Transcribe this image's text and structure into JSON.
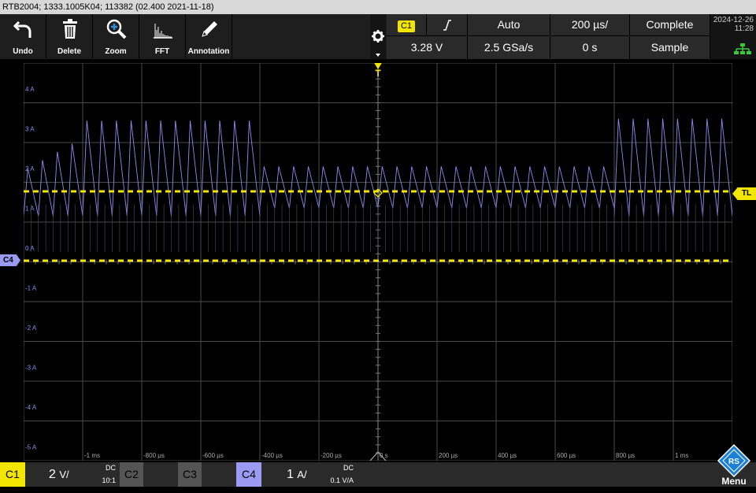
{
  "titlebar": {
    "text": "RTB2004; 1333.1005K04; 113382 (02.400 2021-11-18)"
  },
  "toolbar": [
    {
      "label": "Undo",
      "icon": "undo-icon"
    },
    {
      "label": "Delete",
      "icon": "trash-icon"
    },
    {
      "label": "Zoom",
      "icon": "zoom-icon"
    },
    {
      "label": "FFT",
      "icon": "fft-icon"
    },
    {
      "label": "Annotation",
      "icon": "pencil-icon"
    }
  ],
  "trigger": {
    "source": "C1",
    "slope_icon": "rising-edge-icon",
    "mode": "Auto",
    "level": "3.28 V"
  },
  "acquisition": {
    "sample_rate": "2.5 GSa/s",
    "timebase": "200 µs/",
    "position": "0 s",
    "state": "Complete",
    "acq_mode": "Sample"
  },
  "clock": {
    "date": "2024-12-26",
    "time": "11:28"
  },
  "y_labels": [
    "4 A",
    "3 A",
    "2 A",
    "1 A",
    "0 A",
    "-1 A",
    "-2 A",
    "-3 A",
    "-4 A",
    "-5 A"
  ],
  "x_labels": [
    "-1 ms",
    "-800 µs",
    "-600 µs",
    "-400 µs",
    "-200 µs",
    "0 s",
    "200 µs",
    "400 µs",
    "600 µs",
    "800 µs",
    "1 ms"
  ],
  "markers": {
    "trigger_top": "T",
    "trigger_level": "TL",
    "ch4_offset": "C4"
  },
  "channels": [
    {
      "name": "C1",
      "scale": "2",
      "unit": "V/",
      "coupling": "DC",
      "probe": "10:1",
      "active": true,
      "color": "#f2e600"
    },
    {
      "name": "C2",
      "active": false
    },
    {
      "name": "C3",
      "active": false
    },
    {
      "name": "C4",
      "scale": "1",
      "unit": "A/",
      "coupling": "DC",
      "probe": "0.1 V/A",
      "active": true,
      "color": "#8f8ff0"
    }
  ],
  "menu": {
    "label": "Menu"
  },
  "colors": {
    "ch1": "#f2e600",
    "ch4": "#8c8cf0",
    "grid": "#555555",
    "accent": "#1c7fd6"
  }
}
